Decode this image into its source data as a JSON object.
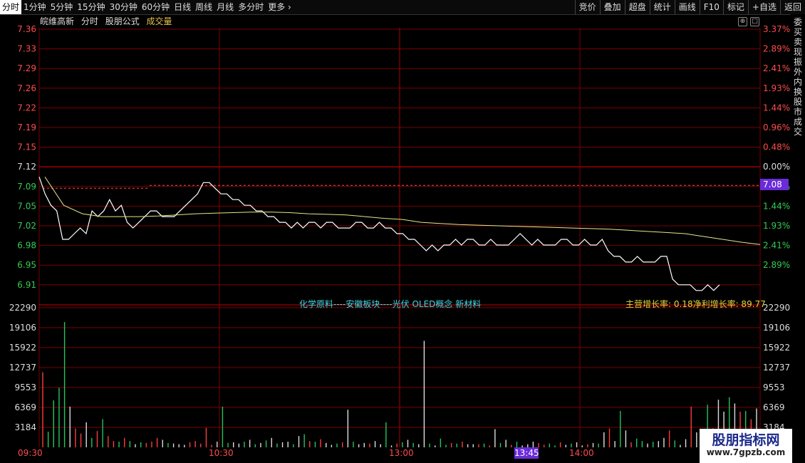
{
  "toolbar": {
    "periods": [
      "分时",
      "1分钟",
      "5分钟",
      "15分钟",
      "30分钟",
      "60分钟",
      "日线",
      "周线",
      "月线",
      "多分时",
      "更多"
    ],
    "more_arrow": "›",
    "active_index": 0,
    "right": [
      "竞价",
      "叠加",
      "超盘",
      "统计",
      "画线",
      "F10",
      "标记",
      "+自选",
      "返回"
    ]
  },
  "header": {
    "stock_name": "皖维高新",
    "mode": "分时",
    "formula": "股朋公式",
    "volume_label": "成交量"
  },
  "price_axis_left": [
    "7.36",
    "7.33",
    "7.29",
    "7.26",
    "7.22",
    "7.19",
    "7.15",
    "7.12",
    "7.09",
    "7.05",
    "7.02",
    "6.98",
    "6.95",
    "6.91"
  ],
  "pct_axis_right": [
    "3.37%",
    "2.89%",
    "2.41%",
    "1.93%",
    "1.44%",
    "0.96%",
    "0.48%",
    "0.00%",
    "0.96%",
    "1.44%",
    "1.93%",
    "2.41%",
    "2.89%"
  ],
  "current_price_badge": "7.08",
  "volume_axis": [
    "22290",
    "19106",
    "15922",
    "12737",
    "9553",
    "6369",
    "3184"
  ],
  "time_labels": [
    "09:30",
    "10:30",
    "13:00",
    "14:00"
  ],
  "cursor_time": "13:45",
  "annotations": {
    "sector": "化学原料----安徽板块----光伏 OLED概念 新材料",
    "finance": "主营增长率: 0.18净利增长率: 89.77"
  },
  "right_strip_text": "委买卖现振外内换股市成交",
  "logo": {
    "main": "股朋指标网",
    "sub": "www.7gpzb.com"
  },
  "colors": {
    "up": "#ff3b3b",
    "down": "#22c55e",
    "price_line": "#ffffff",
    "avg_line": "#e6e68a",
    "grid": "#7a0000"
  },
  "chart_data": {
    "type": "line",
    "prev_close": 7.12,
    "price_range": [
      6.91,
      7.36
    ],
    "series": [
      {
        "values": [
          7.1,
          7.07,
          7.05,
          7.04,
          6.99,
          6.99,
          7.0,
          7.01,
          7.0,
          7.04,
          7.03,
          7.04,
          7.06,
          7.04,
          7.05,
          7.02,
          7.01,
          7.02,
          7.03,
          7.04,
          7.04,
          7.03,
          7.03,
          7.03,
          7.04,
          7.05,
          7.06,
          7.07,
          7.09,
          7.09,
          7.08,
          7.07,
          7.07,
          7.06,
          7.06,
          7.05,
          7.05,
          7.04,
          7.04,
          7.03,
          7.03,
          7.02,
          7.02,
          7.01,
          7.02,
          7.01,
          7.02,
          7.02,
          7.01,
          7.02,
          7.02,
          7.01,
          7.01,
          7.01,
          7.02,
          7.02,
          7.01,
          7.01,
          7.02,
          7.01,
          7.01,
          7.0,
          7.0,
          6.99,
          6.99,
          6.98,
          6.97,
          6.98,
          6.97,
          6.98,
          6.98,
          6.99,
          6.98,
          6.99,
          6.99,
          6.98,
          6.98,
          6.99,
          6.98,
          6.98,
          6.98,
          6.99,
          7.0,
          6.99,
          6.98,
          6.99,
          6.98,
          6.98,
          6.98,
          6.99,
          6.99,
          6.98,
          6.98,
          6.99,
          6.98,
          6.98,
          6.99,
          6.97,
          6.96,
          6.96,
          6.95,
          6.95,
          6.96,
          6.95,
          6.95,
          6.95,
          6.96,
          6.96,
          6.92,
          6.91,
          6.91,
          6.91,
          6.9,
          6.9,
          6.91,
          6.9,
          6.91
        ]
      },
      {
        "values": [
          7.1,
          7.05,
          7.035,
          7.03,
          7.03,
          7.03,
          7.031,
          7.033,
          7.035,
          7.036,
          7.037,
          7.038,
          7.038,
          7.037,
          7.035,
          7.034,
          7.033,
          7.03,
          7.027,
          7.025,
          7.02,
          7.018,
          7.016,
          7.015,
          7.014,
          7.013,
          7.012,
          7.011,
          7.01,
          7.009,
          7.008,
          7.006,
          7.004,
          7.002,
          7.0,
          6.995,
          6.99,
          6.985,
          6.981
        ]
      }
    ],
    "volume_range": [
      0,
      22290
    ],
    "volumes": [
      12000,
      2500,
      7500,
      9500,
      20000,
      6500,
      3000,
      2200,
      4000,
      1500,
      2600,
      4500,
      1800,
      1000,
      900,
      1500,
      1000,
      500,
      800,
      700,
      900,
      1500,
      1200,
      700,
      600,
      500,
      400,
      800,
      1000,
      600,
      3100,
      400,
      900,
      6500,
      700,
      800,
      600,
      900,
      1200,
      500,
      700,
      1100,
      1500,
      600,
      800,
      900,
      500,
      1800,
      2100,
      1000,
      900,
      1300,
      700,
      400,
      600,
      800,
      6000,
      900,
      500,
      700,
      600,
      1000,
      500,
      4000,
      300,
      600,
      800,
      1200,
      700,
      500,
      17000,
      600,
      300,
      1400,
      400,
      700,
      600,
      900,
      500,
      500,
      500,
      600,
      300,
      2900,
      700,
      1200,
      400,
      900,
      300,
      500,
      900,
      700,
      400,
      600,
      300,
      800,
      400,
      600,
      800,
      300,
      500,
      700,
      600,
      2400,
      3000,
      1000,
      5800,
      2700,
      800,
      1400,
      1000,
      600,
      900,
      1000,
      1500,
      2700,
      1100,
      400,
      1300,
      6500,
      2400,
      1000,
      6800,
      3000,
      7600,
      5700,
      8000,
      7000,
      5700,
      5800,
      4500,
      6200
    ]
  }
}
